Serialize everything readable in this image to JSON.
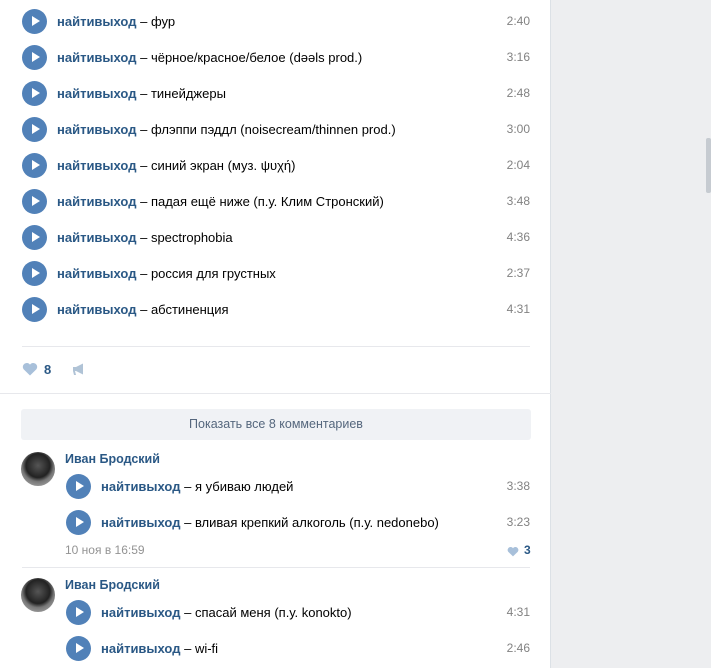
{
  "post": {
    "tracks": [
      {
        "artist": "найтивыход",
        "title": "фур",
        "duration": "2:40"
      },
      {
        "artist": "найтивыход",
        "title": "чёрное/красное/белое (dəəls prod.)",
        "duration": "3:16"
      },
      {
        "artist": "найтивыход",
        "title": "тинейджеры",
        "duration": "2:48"
      },
      {
        "artist": "найтивыход",
        "title": "флэппи пэддл (noisecream/thinnen prod.)",
        "duration": "3:00"
      },
      {
        "artist": "найтивыход",
        "title": "синий экран (муз. ψυχή)",
        "duration": "2:04"
      },
      {
        "artist": "найтивыход",
        "title": "падая ещё ниже (п.у. Клим Стронский)",
        "duration": "3:48"
      },
      {
        "artist": "найтивыход",
        "title": "spectrophobia",
        "duration": "4:36"
      },
      {
        "artist": "найтивыход",
        "title": "россия для грустных",
        "duration": "2:37"
      },
      {
        "artist": "найтивыход",
        "title": "абстиненция",
        "duration": "4:31"
      }
    ],
    "likes": "8",
    "dash": "–"
  },
  "comments": {
    "show_all_label": "Показать все 8 комментариев",
    "items": [
      {
        "author": "Иван Бродский",
        "tracks": [
          {
            "artist": "найтивыход",
            "title": "я убиваю людей",
            "duration": "3:38"
          },
          {
            "artist": "найтивыход",
            "title": "вливая крепкий алкоголь (п.у. nedonebo)",
            "duration": "3:23"
          }
        ],
        "date": "10 ноя в 16:59",
        "likes": "3"
      },
      {
        "author": "Иван Бродский",
        "tracks": [
          {
            "artist": "найтивыход",
            "title": "спасай меня (п.у. konokto)",
            "duration": "4:31"
          },
          {
            "artist": "найтивыход",
            "title": "wi-fi",
            "duration": "2:46"
          }
        ]
      }
    ]
  },
  "colors": {
    "accent": "#5181b8",
    "link": "#2a5885",
    "muted": "#828282"
  }
}
